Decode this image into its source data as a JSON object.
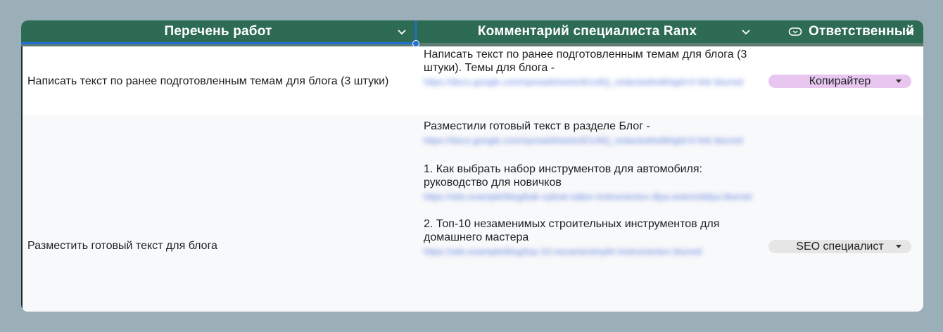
{
  "header": {
    "col1": "Перечень работ",
    "col2": "Комментарий специалиста Ranx",
    "col3": "Ответственный"
  },
  "rows": [
    {
      "task": "Написать текст по ранее подготовленным темам для блога (3 штуки)",
      "comment_text": "Написать текст по ранее подготовленным темам для блога (3 штуки). Темы для блога -",
      "link1": "https://docs.google.com/spreadsheets/d/1x9Q_redacted/edit#gid=0 link blurred",
      "assignee": "Копирайтер"
    },
    {
      "task": "Разместить готовый текст для блога",
      "comment_intro": "Разместили готовый текст в разделе Блог -",
      "link1": "https://docs.google.com/spreadsheets/d/1x9Q_redacted/edit#gid=0 link blurred",
      "item1": "1. Как выбрать набор инструментов для автомобиля: руководство для новичков",
      "link2": "https://site.example/blog/kak-vybrat-nabor-instrumentov-dlya-avtomobilya blurred",
      "item2": "2. Топ-10 незаменимых строительных инструментов для домашнего мастера",
      "link3": "https://site.example/blog/top-10-nezamenimykh-instrumentov blurred",
      "assignee": "SEO специалист"
    }
  ],
  "colors": {
    "header_bg": "#2e6b55",
    "page_bg": "#9aafb8",
    "selection": "#1f6fd6",
    "chip_copywriter": "#e8c6f0",
    "chip_seo": "#e6e6e6"
  },
  "icons": {
    "col_menu": "chevron-down-icon",
    "col3_type": "dropdown-type-icon",
    "chip": "dropdown-triangle-icon"
  }
}
